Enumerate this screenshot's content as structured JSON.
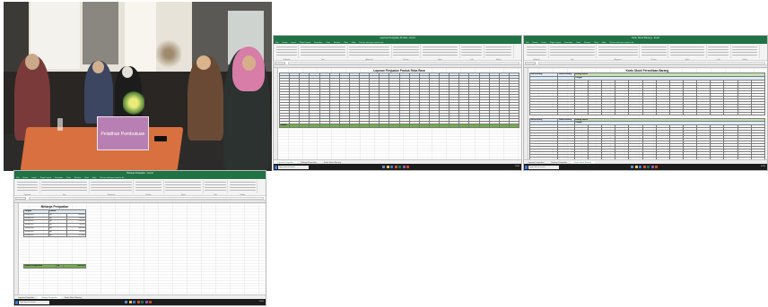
{
  "photo": {
    "banner_text": "Pelatihan Pembukuan"
  },
  "excel": {
    "menu": [
      "File",
      "Home",
      "Insert",
      "Page Layout",
      "Formulas",
      "Data",
      "Review",
      "View",
      "Help",
      "Tell me what you want to do"
    ],
    "ribbon_groups": [
      "Clipboard",
      "Font",
      "Alignment",
      "Number",
      "Styles",
      "Cells",
      "Editing"
    ],
    "taskbar_search": "Type here to search",
    "taskbar_lang": "ENG"
  },
  "win1": {
    "title": "Laporan Penjualan Produk - Excel",
    "sheet_title": "Laporan Penjualan Produk Reka Rasa",
    "tabs": [
      "Laporan Penjualan",
      "Belanja Penjualan",
      "Kartu Stock Barang"
    ],
    "active_tab": 0,
    "total_label": "Jumlah",
    "currency": "Rp",
    "currency_short": "Rp"
  },
  "win2": {
    "title": "Kartu Stock Barang - Excel",
    "sheet_title": "Kartu Stock Persediaan Barang",
    "col_nama": "Nama Barang",
    "col_satuan": "Satuan Barang",
    "col_stok": "Barang Masuk",
    "col_tanggal": "Tanggal",
    "tabs": [
      "Laporan Penjualan",
      "Belanja Penjualan",
      "Kartu Stock Barang"
    ],
    "active_tab": 2
  },
  "win3": {
    "title": "Belanja Penjualan - Excel",
    "sheet_title": "Belanja Penjualan",
    "col_tanggal": "Tanggal",
    "col_jumlah": "Jumlah",
    "rows": [
      {
        "tanggal": "01/06/2020",
        "cur": "Rp",
        "jumlah": "200.000"
      },
      {
        "tanggal": "03/06/2020",
        "cur": "Rp",
        "jumlah": "80.000"
      },
      {
        "tanggal": "06/06/2020",
        "cur": "Rp",
        "jumlah": "150.000"
      },
      {
        "tanggal": "10/06/2020",
        "cur": "Rp",
        "jumlah": "90.000"
      },
      {
        "tanggal": "15/06/2020",
        "cur": "Rp",
        "jumlah": "300.000"
      },
      {
        "tanggal": "20/06/2020",
        "cur": "Rp",
        "jumlah": "60.000"
      },
      {
        "tanggal": "25/06/2020",
        "cur": "Rp",
        "jumlah": "570.000"
      }
    ],
    "total_label": "Jumlah Pengeluaran",
    "total_cur": "Rp",
    "total_value": "1.450.000",
    "tabs": [
      "Laporan Penjualan",
      "Belanja Penjualan",
      "Kartu Stock Barang"
    ],
    "active_tab": 1
  },
  "colors": {
    "excel_green": "#217346",
    "header_blue": "#ddebf7",
    "total_green": "#70ad47"
  }
}
